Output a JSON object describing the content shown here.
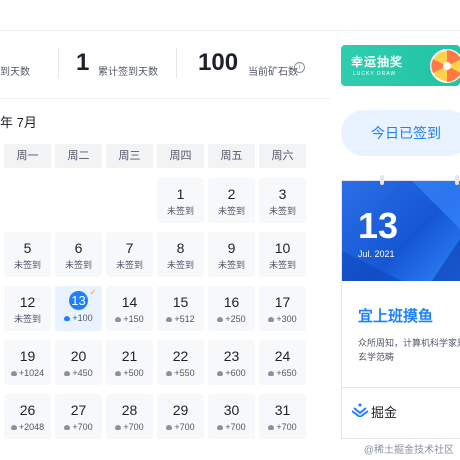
{
  "stats": {
    "streak_label": "到天数",
    "total_value": "1",
    "total_label": "累计签到天数",
    "ore_value": "100",
    "ore_label": "当前矿石数",
    "info_glyph": "i"
  },
  "banner": {
    "title": "幸运抽奖",
    "subtitle": "LUCKY DRAW"
  },
  "calendar": {
    "month_title": "年 7月",
    "weekdays": [
      "周一",
      "周二",
      "周三",
      "周四",
      "周五",
      "周六"
    ],
    "rows": [
      [
        null,
        null,
        null,
        {
          "day": "1",
          "sub": "未签到"
        },
        {
          "day": "2",
          "sub": "未签到"
        },
        {
          "day": "3",
          "sub": "未签到"
        }
      ],
      [
        {
          "day": "5",
          "sub": "未签到"
        },
        {
          "day": "6",
          "sub": "未签到"
        },
        {
          "day": "7",
          "sub": "未签到"
        },
        {
          "day": "8",
          "sub": "未签到"
        },
        {
          "day": "9",
          "sub": "未签到"
        },
        {
          "day": "10",
          "sub": "未签到"
        }
      ],
      [
        {
          "day": "12",
          "sub": "未签到"
        },
        {
          "day": "13",
          "sub": "+100",
          "today": true,
          "ore": true
        },
        {
          "day": "14",
          "sub": "+150",
          "ore": true
        },
        {
          "day": "15",
          "sub": "+512",
          "ore": true
        },
        {
          "day": "16",
          "sub": "+250",
          "ore": true
        },
        {
          "day": "17",
          "sub": "+300",
          "ore": true
        }
      ],
      [
        {
          "day": "19",
          "sub": "+1024",
          "ore": true
        },
        {
          "day": "20",
          "sub": "+450",
          "ore": true
        },
        {
          "day": "21",
          "sub": "+500",
          "ore": true
        },
        {
          "day": "22",
          "sub": "+550",
          "ore": true
        },
        {
          "day": "23",
          "sub": "+600",
          "ore": true
        },
        {
          "day": "24",
          "sub": "+650",
          "ore": true
        }
      ],
      [
        {
          "day": "26",
          "sub": "+2048",
          "ore": true
        },
        {
          "day": "27",
          "sub": "+700",
          "ore": true
        },
        {
          "day": "28",
          "sub": "+700",
          "ore": true
        },
        {
          "day": "29",
          "sub": "+700",
          "ore": true
        },
        {
          "day": "30",
          "sub": "+700",
          "ore": true
        },
        {
          "day": "31",
          "sub": "+700",
          "ore": true
        }
      ]
    ],
    "check_glyph": "✓"
  },
  "sign_button": {
    "label": "今日已签到"
  },
  "date_card": {
    "day": "13",
    "month": "Jul. 2021",
    "motto": "宜上班摸鱼",
    "line1": "众所周知，计算机科学家是",
    "line2": "玄学范畴",
    "brand": "掘金"
  },
  "watermark": "@稀土掘金技术社区",
  "colors": {
    "accent": "#1e80ff",
    "banner": "#21c4a4",
    "check": "#ff9a2e"
  },
  "icons": {
    "info": "info-icon",
    "check": "check-icon",
    "ore": "ore-icon",
    "logo": "juejin-logo-icon"
  }
}
